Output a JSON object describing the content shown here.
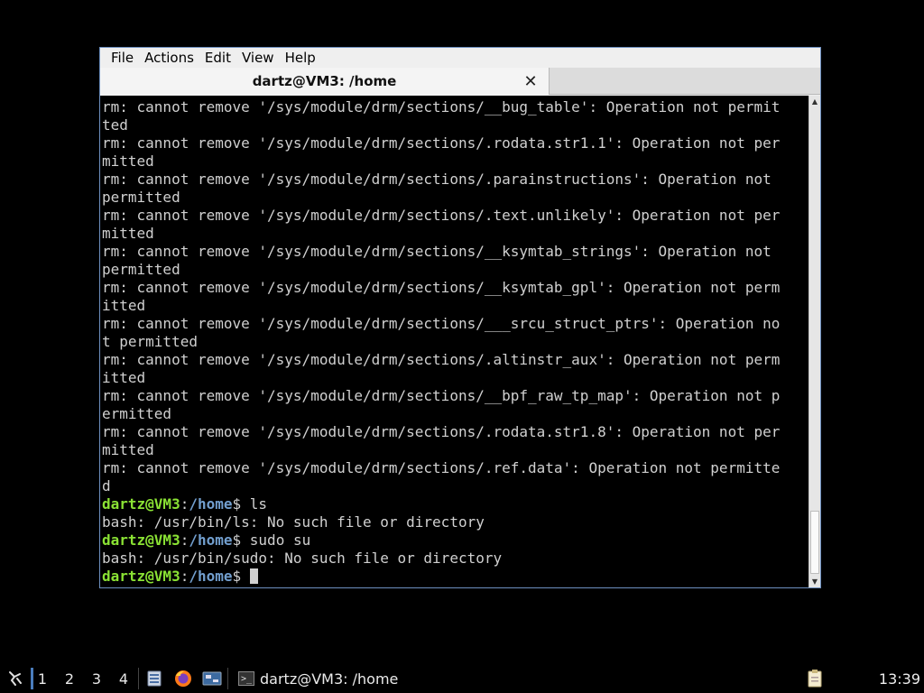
{
  "menu": [
    "File",
    "Actions",
    "Edit",
    "View",
    "Help"
  ],
  "tab": {
    "title": "dartz@VM3: /home",
    "close": "✕"
  },
  "prompt": {
    "user": "dartz@VM3",
    "sep": ":",
    "path": "/home",
    "dollar": "$"
  },
  "terminal_lines": [
    {
      "kind": "text",
      "text": "rm: cannot remove '/sys/module/drm/sections/__bug_table': Operation not permit"
    },
    {
      "kind": "text",
      "text": "ted"
    },
    {
      "kind": "text",
      "text": "rm: cannot remove '/sys/module/drm/sections/.rodata.str1.1': Operation not per"
    },
    {
      "kind": "text",
      "text": "mitted"
    },
    {
      "kind": "text",
      "text": "rm: cannot remove '/sys/module/drm/sections/.parainstructions': Operation not"
    },
    {
      "kind": "text",
      "text": "permitted"
    },
    {
      "kind": "text",
      "text": "rm: cannot remove '/sys/module/drm/sections/.text.unlikely': Operation not per"
    },
    {
      "kind": "text",
      "text": "mitted"
    },
    {
      "kind": "text",
      "text": "rm: cannot remove '/sys/module/drm/sections/__ksymtab_strings': Operation not"
    },
    {
      "kind": "text",
      "text": "permitted"
    },
    {
      "kind": "text",
      "text": "rm: cannot remove '/sys/module/drm/sections/__ksymtab_gpl': Operation not perm"
    },
    {
      "kind": "text",
      "text": "itted"
    },
    {
      "kind": "text",
      "text": "rm: cannot remove '/sys/module/drm/sections/___srcu_struct_ptrs': Operation no"
    },
    {
      "kind": "text",
      "text": "t permitted"
    },
    {
      "kind": "text",
      "text": "rm: cannot remove '/sys/module/drm/sections/.altinstr_aux': Operation not perm"
    },
    {
      "kind": "text",
      "text": "itted"
    },
    {
      "kind": "text",
      "text": "rm: cannot remove '/sys/module/drm/sections/__bpf_raw_tp_map': Operation not p"
    },
    {
      "kind": "text",
      "text": "ermitted"
    },
    {
      "kind": "text",
      "text": "rm: cannot remove '/sys/module/drm/sections/.rodata.str1.8': Operation not per"
    },
    {
      "kind": "text",
      "text": "mitted"
    },
    {
      "kind": "text",
      "text": "rm: cannot remove '/sys/module/drm/sections/.ref.data': Operation not permitte"
    },
    {
      "kind": "text",
      "text": "d"
    },
    {
      "kind": "prompt",
      "text": " ls"
    },
    {
      "kind": "text",
      "text": "bash: /usr/bin/ls: No such file or directory"
    },
    {
      "kind": "prompt",
      "text": " sudo su"
    },
    {
      "kind": "text",
      "text": "bash: /usr/bin/sudo: No such file or directory"
    },
    {
      "kind": "prompt",
      "text": " ",
      "cursor": true
    }
  ],
  "taskbar": {
    "workspaces": [
      "1",
      "2",
      "3",
      "4"
    ],
    "active_workspace": "1",
    "task_label": "dartz@VM3: /home",
    "clock": "13:39"
  },
  "colors": {
    "prompt_user": "#8ae234",
    "prompt_path": "#729fcf",
    "window_border": "#6d8fbf"
  }
}
